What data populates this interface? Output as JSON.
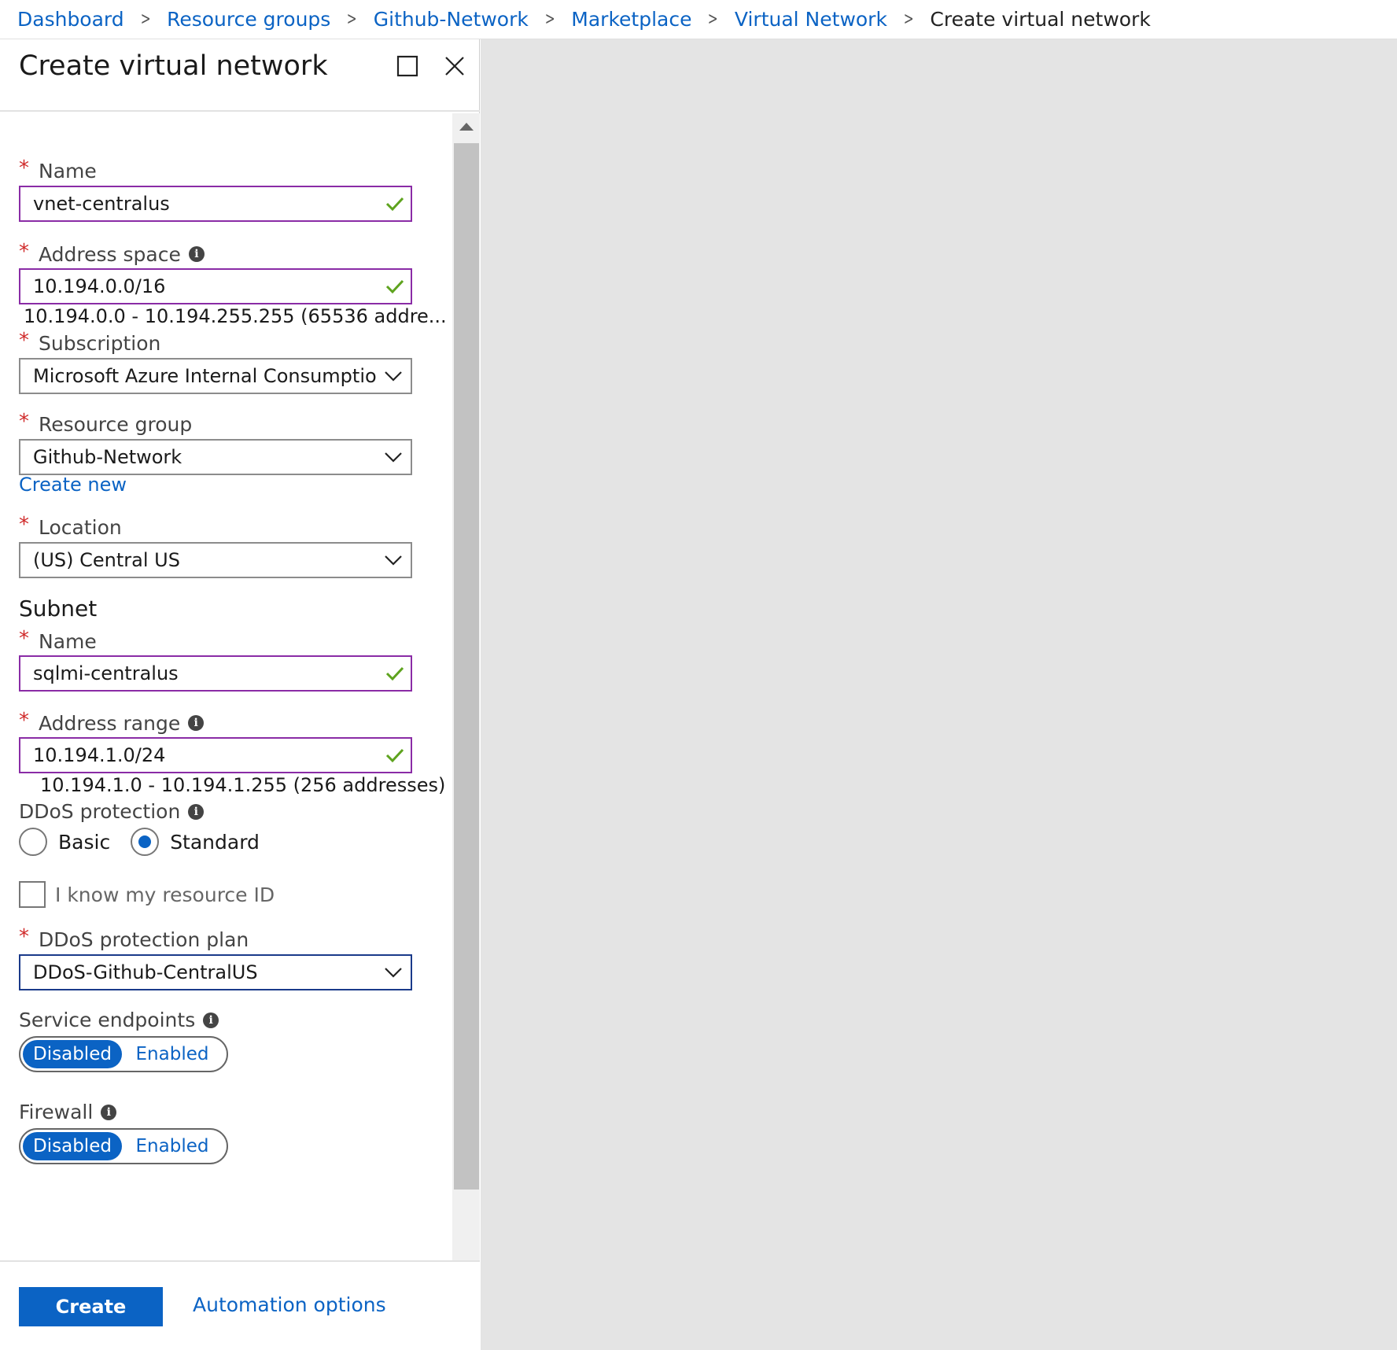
{
  "breadcrumb": {
    "items": [
      "Dashboard",
      "Resource groups",
      "Github-Network",
      "Marketplace",
      "Virtual Network"
    ],
    "current": "Create virtual network"
  },
  "blade": {
    "title": "Create virtual network",
    "maximize_icon": "maximize-icon",
    "close_icon": "close-icon"
  },
  "form": {
    "name": {
      "label": "Name",
      "value": "vnet-centralus"
    },
    "address_space": {
      "label": "Address space",
      "value": "10.194.0.0/16",
      "helper": "10.194.0.0 - 10.194.255.255 (65536 addre..."
    },
    "subscription": {
      "label": "Subscription",
      "value": "Microsoft Azure Internal Consumption"
    },
    "resource_group": {
      "label": "Resource group",
      "value": "Github-Network",
      "create_new": "Create new"
    },
    "location": {
      "label": "Location",
      "value": "(US) Central US"
    },
    "subnet": {
      "title": "Subnet",
      "name": {
        "label": "Name",
        "value": "sqlmi-centralus"
      },
      "address_range": {
        "label": "Address range",
        "value": "10.194.1.0/24",
        "helper": "10.194.1.0 - 10.194.1.255 (256 addresses)"
      }
    },
    "ddos": {
      "label": "DDoS protection",
      "options": [
        "Basic",
        "Standard"
      ],
      "selected": "Standard",
      "resource_id_checkbox": "I know my resource ID",
      "plan_label": "DDoS protection plan",
      "plan_value": "DDoS-Github-CentralUS"
    },
    "service_endpoints": {
      "label": "Service endpoints",
      "options": [
        "Disabled",
        "Enabled"
      ],
      "selected": "Disabled"
    },
    "firewall": {
      "label": "Firewall",
      "options": [
        "Disabled",
        "Enabled"
      ],
      "selected": "Disabled"
    }
  },
  "footer": {
    "create_label": "Create",
    "automation_label": "Automation options"
  },
  "colors": {
    "accent": "#0b63c4",
    "required": "#d02b2b",
    "valid_check": "#5ea31e",
    "input_border_active": "#8a2ca6",
    "backdrop": "#e4e4e4"
  }
}
